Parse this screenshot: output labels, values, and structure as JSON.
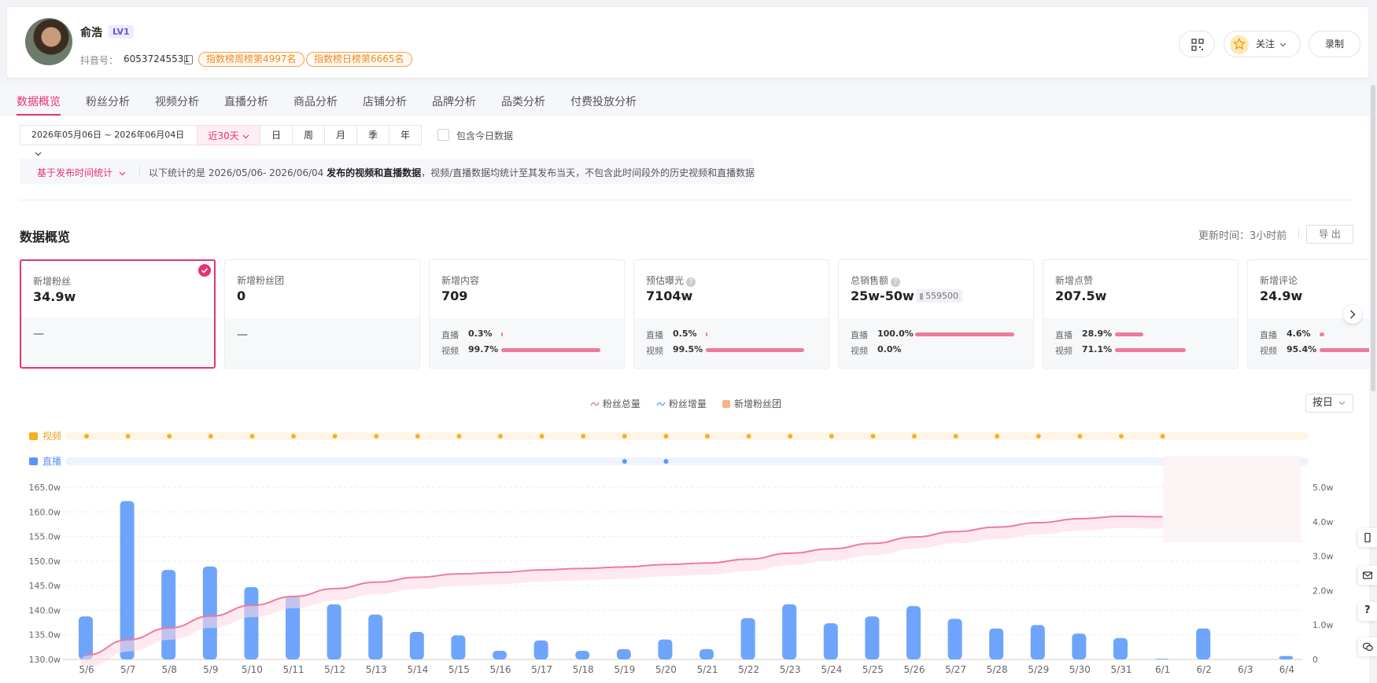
{
  "profile": {
    "name": "俞浩",
    "level": "LV1",
    "douyin_label": "抖音号：",
    "douyin_id": "60537245531",
    "rank_week": "指数榜周榜第4997名",
    "rank_day": "指数榜日榜第6665名",
    "follow_label": "关注",
    "record_label": "录制"
  },
  "tabs": [
    "数据概览",
    "粉丝分析",
    "视频分析",
    "直播分析",
    "商品分析",
    "店铺分析",
    "品牌分析",
    "品类分析",
    "付费投放分析"
  ],
  "filters": {
    "date_range": "2026年05月06日 ~ 2026年06月04日",
    "quick_range": "近30天",
    "periods": [
      "日",
      "周",
      "月",
      "季",
      "年"
    ],
    "include_today": "包含今日数据"
  },
  "notice": {
    "mode": "基于发布时间统计",
    "prefix": "以下统计的是 2026/05/06- 2026/06/04 ",
    "bold": "发布的视频和直播数据",
    "suffix": "，视频/直播数据均统计至其发布当天，不包含此时间段外的历史视频和直播数据"
  },
  "overview": {
    "title": "数据概览",
    "update_time": "更新时间：3小时前",
    "export": "导 出"
  },
  "metrics": [
    {
      "title": "新增粉丝",
      "value": "34.9w",
      "empty": "—"
    },
    {
      "title": "新增粉丝团",
      "value": "0",
      "empty": "—"
    },
    {
      "title": "新增内容",
      "value": "709",
      "live_label": "直播",
      "live_pct": "0.3%",
      "live_share": 0.003,
      "video_label": "视频",
      "video_pct": "99.7%",
      "video_share": 0.997
    },
    {
      "title": "预估曝光",
      "value": "7104w",
      "live_label": "直播",
      "live_pct": "0.5%",
      "live_share": 0.005,
      "video_label": "视频",
      "video_pct": "99.5%",
      "video_share": 0.995
    },
    {
      "title": "总销售额",
      "value": "25w-50w",
      "badge": "559500",
      "live_label": "直播",
      "live_pct": "100.0%",
      "live_share": 1.0,
      "video_label": "视频",
      "video_pct": "0.0%",
      "video_share": 0.0
    },
    {
      "title": "新增点赞",
      "value": "207.5w",
      "live_label": "直播",
      "live_pct": "28.9%",
      "live_share": 0.289,
      "video_label": "视频",
      "video_pct": "71.1%",
      "video_share": 0.711
    },
    {
      "title": "新增评论",
      "value": "24.9w",
      "live_label": "直播",
      "live_pct": "4.6%",
      "live_share": 0.046,
      "video_label": "视频",
      "video_pct": "95.4%",
      "video_share": 0.954
    }
  ],
  "chart_controls": {
    "legend_total": "粉丝总量",
    "legend_increase": "粉丝增量",
    "legend_fan_group": "新增粉丝团",
    "granularity": "按日",
    "video_row_label": "视频",
    "live_row_label": "直播"
  },
  "colors": {
    "accent": "#e5346d",
    "bar": "#6ea4fb",
    "line": "#f07a9b",
    "video_marker": "#f5b21f",
    "live_marker": "#5b95f5"
  },
  "chart_data": {
    "type": "bar",
    "categories": [
      "5/6",
      "5/7",
      "5/8",
      "5/9",
      "5/10",
      "5/11",
      "5/12",
      "5/13",
      "5/14",
      "5/15",
      "5/16",
      "5/17",
      "5/18",
      "5/19",
      "5/20",
      "5/21",
      "5/22",
      "5/23",
      "5/24",
      "5/25",
      "5/26",
      "5/27",
      "5/28",
      "5/29",
      "5/30",
      "5/31",
      "6/1",
      "6/2",
      "6/3",
      "6/4"
    ],
    "y_left": {
      "ylim": [
        130,
        165
      ],
      "ticks": [
        "165.0w",
        "160.0w",
        "155.0w",
        "150.0w",
        "145.0w",
        "140.0w",
        "135.0w",
        "130.0w"
      ],
      "tick_values": [
        165,
        160,
        155,
        150,
        145,
        140,
        135,
        130
      ]
    },
    "y_right": {
      "ylim": [
        0,
        5
      ],
      "ticks": [
        "5.0w",
        "4.0w",
        "3.0w",
        "2.0w",
        "1.0w",
        "0"
      ],
      "tick_values": [
        5,
        4,
        3,
        2,
        1,
        0
      ]
    },
    "series": [
      {
        "name": "粉丝增量",
        "type": "bar",
        "axis": "right",
        "values": [
          1.25,
          4.6,
          2.6,
          2.7,
          2.1,
          1.85,
          1.6,
          1.3,
          0.8,
          0.7,
          0.25,
          0.55,
          0.25,
          0.3,
          0.58,
          0.3,
          1.2,
          1.6,
          1.05,
          1.25,
          1.55,
          1.18,
          0.9,
          1.0,
          0.75,
          0.62,
          0.02,
          0.9,
          0,
          0.1
        ]
      },
      {
        "name": "粉丝总量",
        "type": "line",
        "axis": "left",
        "values": [
          130.9,
          134.0,
          136.4,
          138.8,
          141.0,
          142.8,
          144.4,
          145.7,
          146.7,
          147.4,
          147.7,
          148.2,
          148.5,
          148.8,
          149.3,
          149.6,
          150.4,
          151.6,
          152.5,
          153.6,
          154.9,
          156.0,
          156.9,
          157.8,
          158.6,
          159.1,
          159.0
        ]
      }
    ],
    "video_days": [
      0,
      1,
      2,
      3,
      4,
      5,
      6,
      7,
      8,
      9,
      10,
      11,
      12,
      13,
      14,
      15,
      16,
      17,
      18,
      19,
      20,
      21,
      22,
      23,
      24,
      25,
      26
    ],
    "live_days": [
      13,
      14
    ]
  }
}
